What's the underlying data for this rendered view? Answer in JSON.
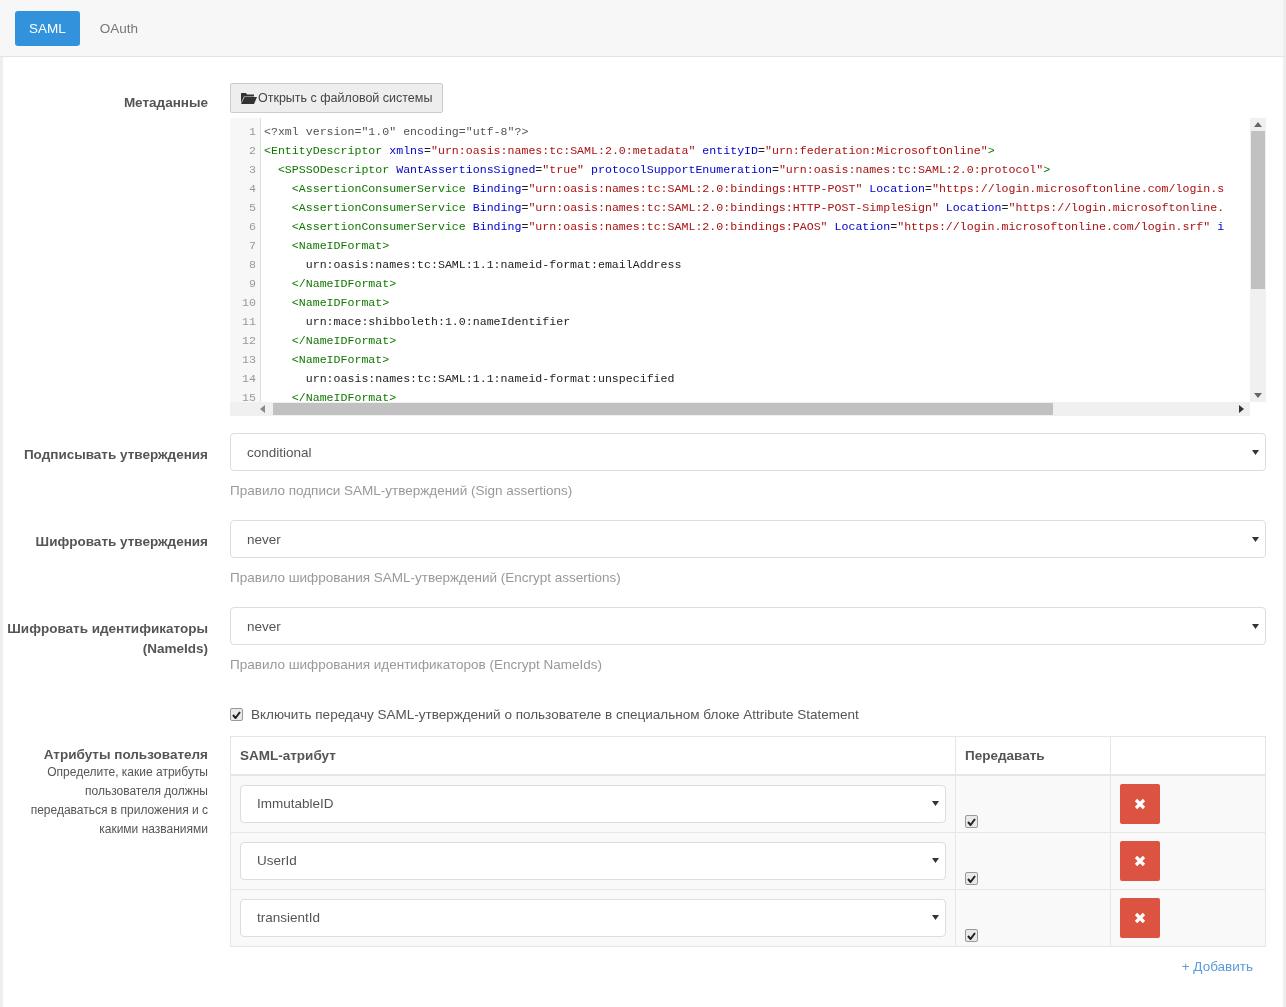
{
  "tabs": [
    {
      "label": "SAML",
      "selected": true
    },
    {
      "label": "OAuth",
      "selected": false
    }
  ],
  "metadata": {
    "label": "Метаданные",
    "open_button": "Открыть с файловой системы",
    "code_lines": [
      {
        "number": "1",
        "tokens": [
          {
            "kind": "meta",
            "text": "<?xml version=\"1.0\" encoding=\"utf-8\"?>"
          }
        ]
      },
      {
        "number": "2",
        "tokens": [
          {
            "kind": "tag",
            "text": "<EntityDescriptor"
          },
          {
            "kind": "attr",
            "text": " xmlns"
          },
          {
            "kind": "plain",
            "text": "="
          },
          {
            "kind": "string",
            "text": "\"urn:oasis:names:tc:SAML:2.0:metadata\""
          },
          {
            "kind": "attr",
            "text": " entityID"
          },
          {
            "kind": "plain",
            "text": "="
          },
          {
            "kind": "string",
            "text": "\"urn:federation:MicrosoftOnline\""
          },
          {
            "kind": "tag",
            "text": ">"
          }
        ]
      },
      {
        "number": "3",
        "tokens": [
          {
            "kind": "tag",
            "text": "  <SPSSODescriptor"
          },
          {
            "kind": "attr",
            "text": " WantAssertionsSigned"
          },
          {
            "kind": "plain",
            "text": "="
          },
          {
            "kind": "string",
            "text": "\"true\""
          },
          {
            "kind": "attr",
            "text": " protocolSupportEnumeration"
          },
          {
            "kind": "plain",
            "text": "="
          },
          {
            "kind": "string",
            "text": "\"urn:oasis:names:tc:SAML:2.0:protocol\""
          },
          {
            "kind": "tag",
            "text": ">"
          }
        ]
      },
      {
        "number": "4",
        "tokens": [
          {
            "kind": "tag",
            "text": "    <AssertionConsumerService"
          },
          {
            "kind": "attr",
            "text": " Binding"
          },
          {
            "kind": "plain",
            "text": "="
          },
          {
            "kind": "string",
            "text": "\"urn:oasis:names:tc:SAML:2.0:bindings:HTTP-POST\""
          },
          {
            "kind": "attr",
            "text": " Location"
          },
          {
            "kind": "plain",
            "text": "="
          },
          {
            "kind": "string",
            "text": "\"https://login.microsoftonline.com/login.s"
          }
        ]
      },
      {
        "number": "5",
        "tokens": [
          {
            "kind": "tag",
            "text": "    <AssertionConsumerService"
          },
          {
            "kind": "attr",
            "text": " Binding"
          },
          {
            "kind": "plain",
            "text": "="
          },
          {
            "kind": "string",
            "text": "\"urn:oasis:names:tc:SAML:2.0:bindings:HTTP-POST-SimpleSign\""
          },
          {
            "kind": "attr",
            "text": " Location"
          },
          {
            "kind": "plain",
            "text": "="
          },
          {
            "kind": "string",
            "text": "\"https://login.microsoftonline."
          }
        ]
      },
      {
        "number": "6",
        "tokens": [
          {
            "kind": "tag",
            "text": "    <AssertionConsumerService"
          },
          {
            "kind": "attr",
            "text": " Binding"
          },
          {
            "kind": "plain",
            "text": "="
          },
          {
            "kind": "string",
            "text": "\"urn:oasis:names:tc:SAML:2.0:bindings:PAOS\""
          },
          {
            "kind": "attr",
            "text": " Location"
          },
          {
            "kind": "plain",
            "text": "="
          },
          {
            "kind": "string",
            "text": "\"https://login.microsoftonline.com/login.srf\""
          },
          {
            "kind": "attr",
            "text": " i"
          }
        ]
      },
      {
        "number": "7",
        "tokens": [
          {
            "kind": "tag",
            "text": "    <NameIDFormat>"
          }
        ]
      },
      {
        "number": "8",
        "tokens": [
          {
            "kind": "plain",
            "text": "      urn:oasis:names:tc:SAML:1.1:nameid-format:emailAddress"
          }
        ]
      },
      {
        "number": "9",
        "tokens": [
          {
            "kind": "tag",
            "text": "    </NameIDFormat>"
          }
        ]
      },
      {
        "number": "10",
        "tokens": [
          {
            "kind": "tag",
            "text": "    <NameIDFormat>"
          }
        ]
      },
      {
        "number": "11",
        "tokens": [
          {
            "kind": "plain",
            "text": "      urn:mace:shibboleth:1.0:nameIdentifier"
          }
        ]
      },
      {
        "number": "12",
        "tokens": [
          {
            "kind": "tag",
            "text": "    </NameIDFormat>"
          }
        ]
      },
      {
        "number": "13",
        "tokens": [
          {
            "kind": "tag",
            "text": "    <NameIDFormat>"
          }
        ]
      },
      {
        "number": "14",
        "tokens": [
          {
            "kind": "plain",
            "text": "      urn:oasis:names:tc:SAML:1.1:nameid-format:unspecified"
          }
        ]
      },
      {
        "number": "15",
        "tokens": [
          {
            "kind": "tag",
            "text": "    </NameIDFormat>"
          }
        ]
      }
    ]
  },
  "fields": [
    {
      "label": "Подписывать утверждения",
      "value": "conditional",
      "help": "Правило подписи SAML-утверждений (Sign assertions)"
    },
    {
      "label": "Шифровать утверждения",
      "value": "never",
      "help": "Правило шифрования SAML-утверждений (Encrypt assertions)"
    },
    {
      "label": "Шифровать идентификаторы (NameIds)",
      "value": "never",
      "help": "Правило шифрования идентификаторов (Encrypt NameIds)"
    }
  ],
  "attribute_statement": {
    "checked": true,
    "label": "Включить передачу SAML-утверждений о пользователе в специальном блоке Attribute Statement"
  },
  "attributes": {
    "label": "Атрибуты пользователя",
    "description": "Определите, какие атрибуты пользователя должны передаваться в приложения и с какими названиями",
    "columns": [
      "SAML-атрибут",
      "Передавать"
    ],
    "rows": [
      {
        "value": "ImmutableID",
        "send": true
      },
      {
        "value": "UserId",
        "send": true
      },
      {
        "value": "transientId",
        "send": true
      }
    ],
    "add_link": "+ Добавить"
  }
}
